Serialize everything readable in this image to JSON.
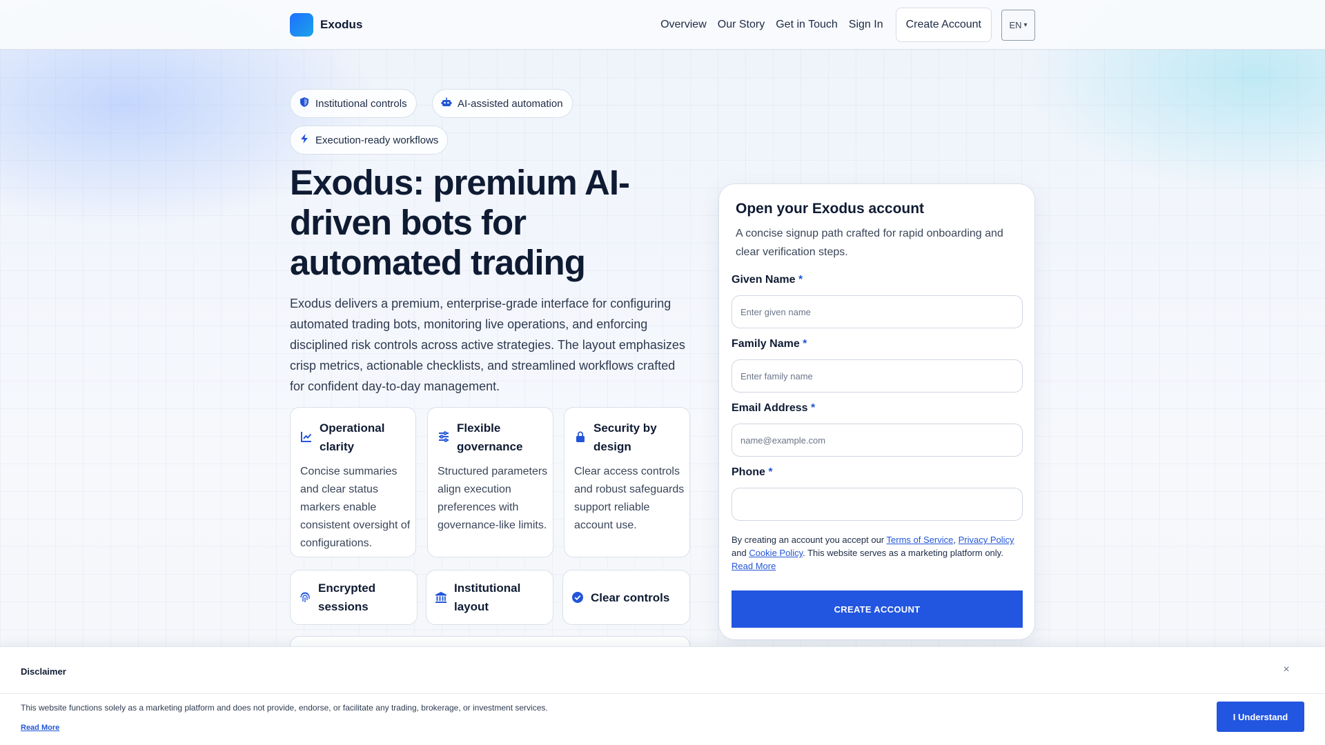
{
  "header": {
    "brand": "Exodus",
    "nav": [
      "Overview",
      "Our Story",
      "Get in Touch",
      "Sign In"
    ],
    "create_account": "Create Account",
    "language": "EN",
    "language_caret": "▾"
  },
  "hero": {
    "pills": [
      "Institutional controls",
      "AI-assisted automation",
      "Execution-ready workflows"
    ],
    "title": "Exodus: premium AI-driven bots for automated trading",
    "description": "Exodus delivers a premium, enterprise-grade interface for configuring automated trading bots, monitoring live operations, and enforcing disciplined risk controls across active strategies. The layout emphasizes crisp metrics, actionable checklists, and streamlined workflows crafted for confident day-to-day management.",
    "features": [
      {
        "title": "Operational clarity",
        "body": "Concise summaries and clear status markers enable consistent oversight of configurations.",
        "icon": "chart-line-icon"
      },
      {
        "title": "Flexible governance",
        "body": "Structured parameters align execution preferences with governance-like limits.",
        "icon": "sliders-icon"
      },
      {
        "title": "Security by design",
        "body": "Clear access controls and robust safeguards support reliable account use.",
        "icon": "lock-icon"
      }
    ],
    "mini_features": [
      {
        "title": "Encrypted sessions",
        "icon": "fingerprint-icon"
      },
      {
        "title": "Institutional layout",
        "icon": "bank-icon"
      },
      {
        "title": "Clear controls",
        "icon": "check-circle-icon"
      }
    ]
  },
  "form": {
    "title": "Open your Exodus account",
    "subtitle": "A concise signup path crafted for rapid onboarding and clear verification steps.",
    "required_mark": "*",
    "fields": [
      {
        "label": "Given Name",
        "placeholder": "Enter given name",
        "value": ""
      },
      {
        "label": "Family Name",
        "placeholder": "Enter family name",
        "value": ""
      },
      {
        "label": "Email Address",
        "placeholder": "name@example.com",
        "value": ""
      },
      {
        "label": "Phone",
        "placeholder": "",
        "value": ""
      }
    ],
    "terms": {
      "prefix": "By creating an account you accept our",
      "tos": "Terms of Service",
      "comma": ",",
      "privacy": "Privacy Policy",
      "and": "and",
      "cookie": "Cookie Policy",
      "suffix": ". This website serves as a marketing platform only.",
      "read_more": "Read More"
    },
    "submit": "CREATE ACCOUNT"
  },
  "disclaimer": {
    "title": "Disclaimer",
    "close": "×",
    "text": "This website functions solely as a marketing platform and does not provide, endorse, or facilitate any trading, brokerage, or investment services.",
    "read_more": "Read More",
    "accept": "I Understand"
  }
}
